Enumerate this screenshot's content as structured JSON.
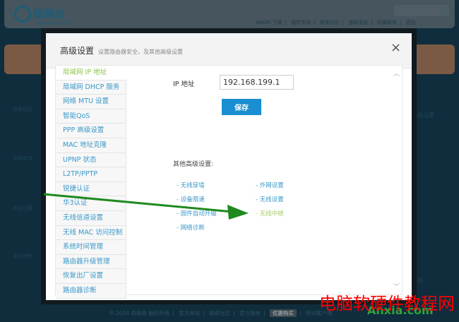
{
  "header": {
    "logo": "极路由",
    "logo_sub": "www.hiwifi.com",
    "top_links": [
      "HiWiFi 下载",
      "插件市场",
      "极客社区",
      "通知消息",
      "切换账号",
      "退出"
    ]
  },
  "background": {
    "side": [
      "极客社区",
      "系统状态",
      "高级设置",
      "手机控制"
    ],
    "right": [
      "无线设置",
      "关机"
    ]
  },
  "modal": {
    "title": "高级设置",
    "subtitle": "设置路由器安全，及其他高级设置",
    "close": "×",
    "sidebar": [
      "局域网 IP 地址",
      "局域网 DHCP 服务",
      "网络 MTU 设置",
      "智能QoS",
      "PPP 高级设置",
      "MAC 地址克隆",
      "UPNP 状态",
      "L2TP/PPTP",
      "锐捷认证",
      "华3认证",
      "无线信道设置",
      "无线 MAC 访问控制",
      "系统时间管理",
      "路由器升级管理",
      "恢复出厂设置",
      "路由器诊断"
    ],
    "active_index": 0,
    "ip_label": "IP 地址",
    "ip_value": "192.168.199.1",
    "save": "保存",
    "other_label": "其他高级设置:",
    "links_left": [
      "- 无线穿墙",
      "- 设备限速",
      "- 固件自动升级",
      "- 网络诊断"
    ],
    "links_right": [
      "- 外网设置",
      "- 无线设置",
      "- 无线中继"
    ],
    "highlighted_link": "- 无线中继"
  },
  "footer": {
    "items": [
      "© 2014 极路由 版权所有",
      "官方网站",
      "极客社区",
      "官方微信",
      "优惠购买",
      "移动客户端"
    ]
  },
  "watermark": {
    "cn": "电脑软硬件教程网",
    "en": "Anxia.com"
  },
  "colors": {
    "accent": "#1a8ed0",
    "active": "#8fc34a",
    "arrow": "#1e8a1e"
  }
}
